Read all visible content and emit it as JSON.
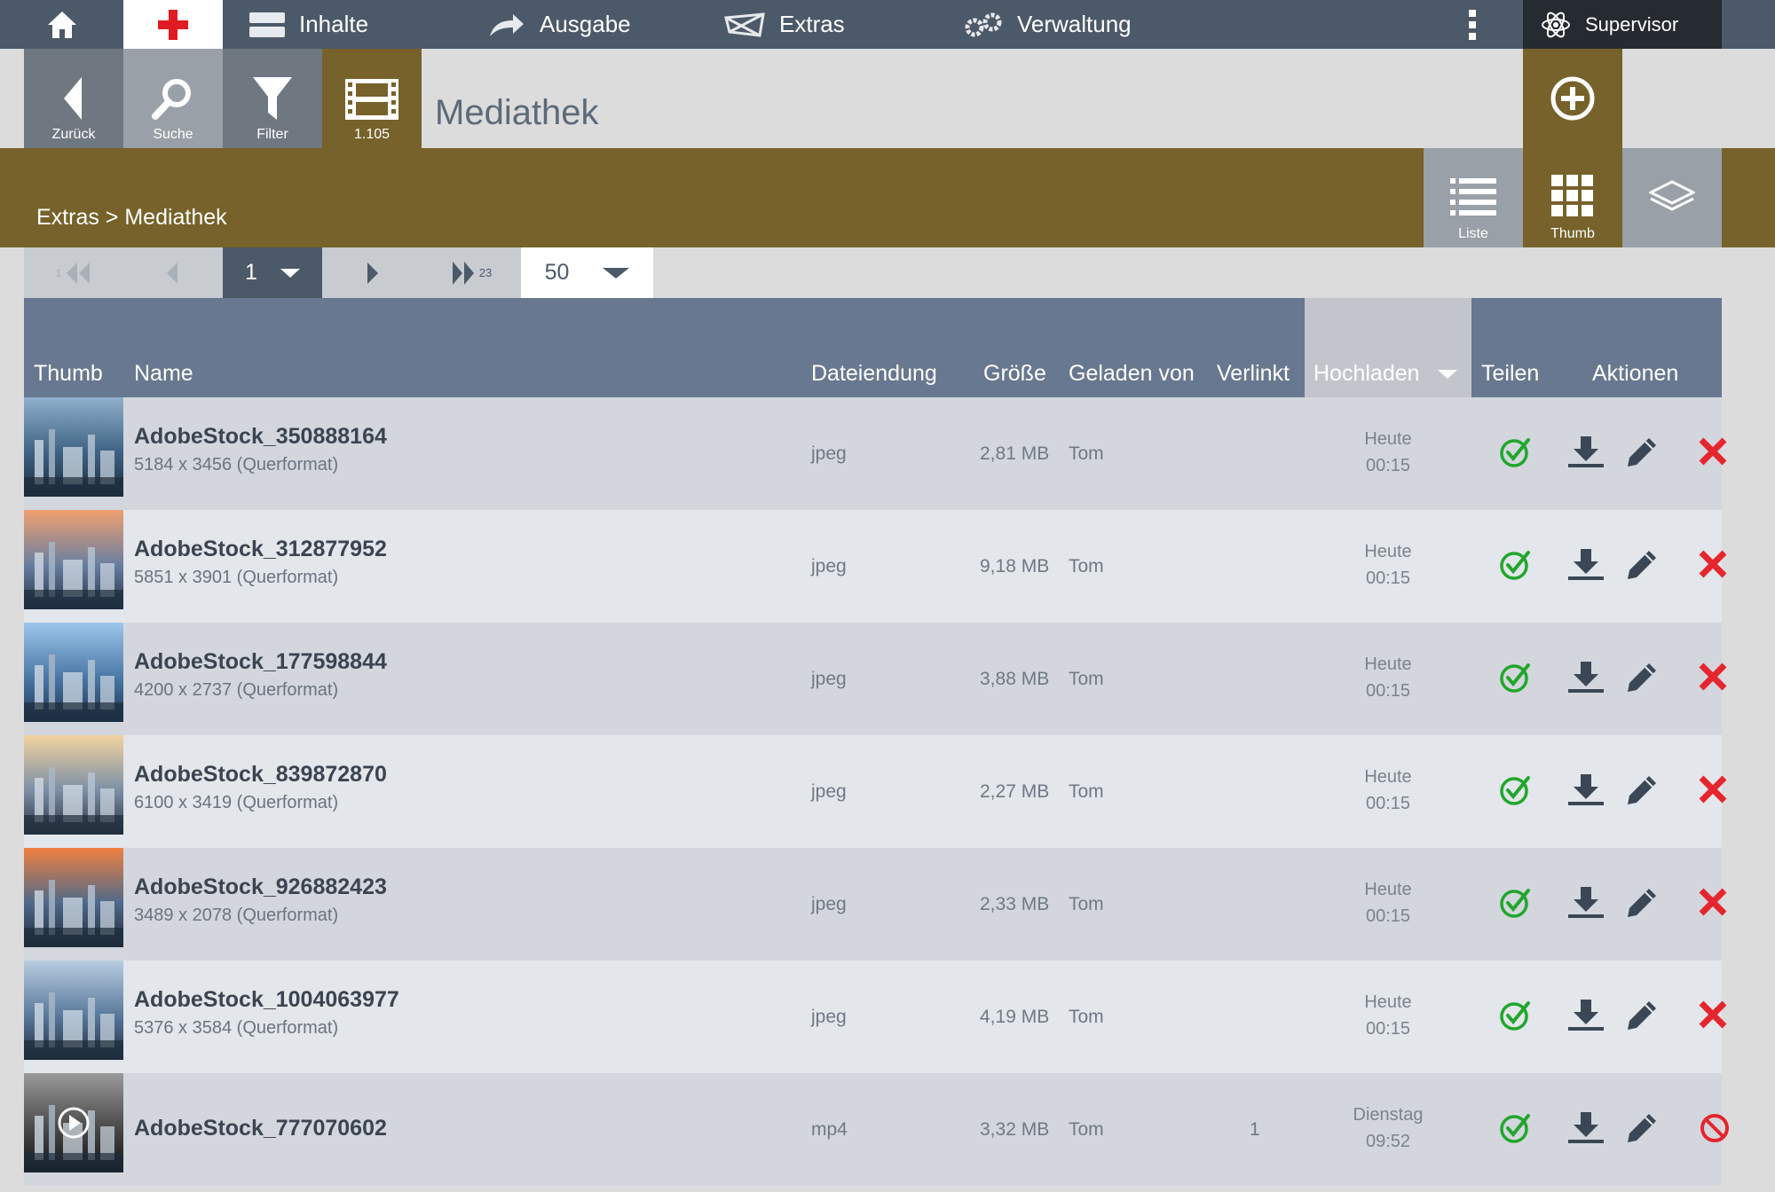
{
  "topnav": {
    "items": [
      {
        "label": "Inhalte",
        "icon": "content-icon"
      },
      {
        "label": "Ausgabe",
        "icon": "output-arrow-icon"
      },
      {
        "label": "Extras",
        "icon": "extras-icon"
      },
      {
        "label": "Verwaltung",
        "icon": "gears-icon"
      }
    ],
    "user": "Supervisor"
  },
  "toolbar": {
    "back_label": "Zurück",
    "search_label": "Suche",
    "filter_label": "Filter",
    "count_label": "1.105",
    "title": "Mediathek"
  },
  "breadcrumb": "Extras > Mediathek",
  "view_buttons": {
    "list_label": "Liste",
    "thumb_label": "Thumb"
  },
  "pager": {
    "first_num": "1",
    "page": "1",
    "last_num": "23",
    "per_page": "50"
  },
  "columns": {
    "thumb": "Thumb",
    "name": "Name",
    "ext": "Dateiendung",
    "size": "Größe",
    "uploaded_by": "Geladen von",
    "linked": "Verlinkt",
    "upload": "Hochladen",
    "share": "Teilen",
    "actions": "Aktionen"
  },
  "rows": [
    {
      "name": "AdobeStock_350888164",
      "dims": "5184 x 3456 (Querformat)",
      "ext": "jpeg",
      "size": "2,81 MB",
      "by": "Tom",
      "linked": "",
      "day": "Heute",
      "time": "00:15",
      "deletable": true
    },
    {
      "name": "AdobeStock_312877952",
      "dims": "5851 x 3901 (Querformat)",
      "ext": "jpeg",
      "size": "9,18 MB",
      "by": "Tom",
      "linked": "",
      "day": "Heute",
      "time": "00:15",
      "deletable": true
    },
    {
      "name": "AdobeStock_177598844",
      "dims": "4200 x 2737 (Querformat)",
      "ext": "jpeg",
      "size": "3,88 MB",
      "by": "Tom",
      "linked": "",
      "day": "Heute",
      "time": "00:15",
      "deletable": true
    },
    {
      "name": "AdobeStock_839872870",
      "dims": "6100 x 3419 (Querformat)",
      "ext": "jpeg",
      "size": "2,27 MB",
      "by": "Tom",
      "linked": "",
      "day": "Heute",
      "time": "00:15",
      "deletable": true
    },
    {
      "name": "AdobeStock_926882423",
      "dims": "3489 x 2078 (Querformat)",
      "ext": "jpeg",
      "size": "2,33 MB",
      "by": "Tom",
      "linked": "",
      "day": "Heute",
      "time": "00:15",
      "deletable": true
    },
    {
      "name": "AdobeStock_1004063977",
      "dims": "5376 x 3584 (Querformat)",
      "ext": "jpeg",
      "size": "4,19 MB",
      "by": "Tom",
      "linked": "",
      "day": "Heute",
      "time": "00:15",
      "deletable": true
    },
    {
      "name": "AdobeStock_777070602",
      "dims": "",
      "ext": "mp4",
      "size": "3,32 MB",
      "by": "Tom",
      "linked": "1",
      "day": "Dienstag",
      "time": "09:52",
      "deletable": false
    }
  ],
  "colors": {
    "nav": "#4c5969",
    "olive": "#76622a",
    "header": "#687890",
    "share_green": "#21a62c",
    "delete_red": "#e5262f"
  }
}
